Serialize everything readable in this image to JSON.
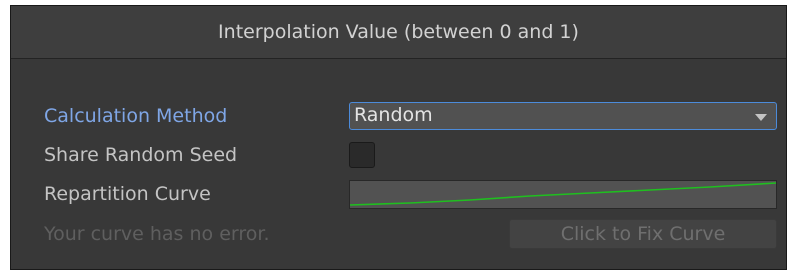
{
  "header": {
    "title": "Interpolation Value (between 0 and 1)"
  },
  "fields": {
    "calculation_method": {
      "label": "Calculation Method",
      "selected": "Random"
    },
    "share_random_seed": {
      "label": "Share Random Seed",
      "checked": false
    },
    "repartition_curve": {
      "label": "Repartition Curve",
      "curve_color": "#1fbf1f"
    }
  },
  "status": {
    "message": "Your curve has no error.",
    "fix_button_label": "Click to Fix Curve"
  },
  "colors": {
    "panel_bg": "#383838",
    "focus_accent": "#4c8bda",
    "active_label": "#7fa6e6"
  }
}
